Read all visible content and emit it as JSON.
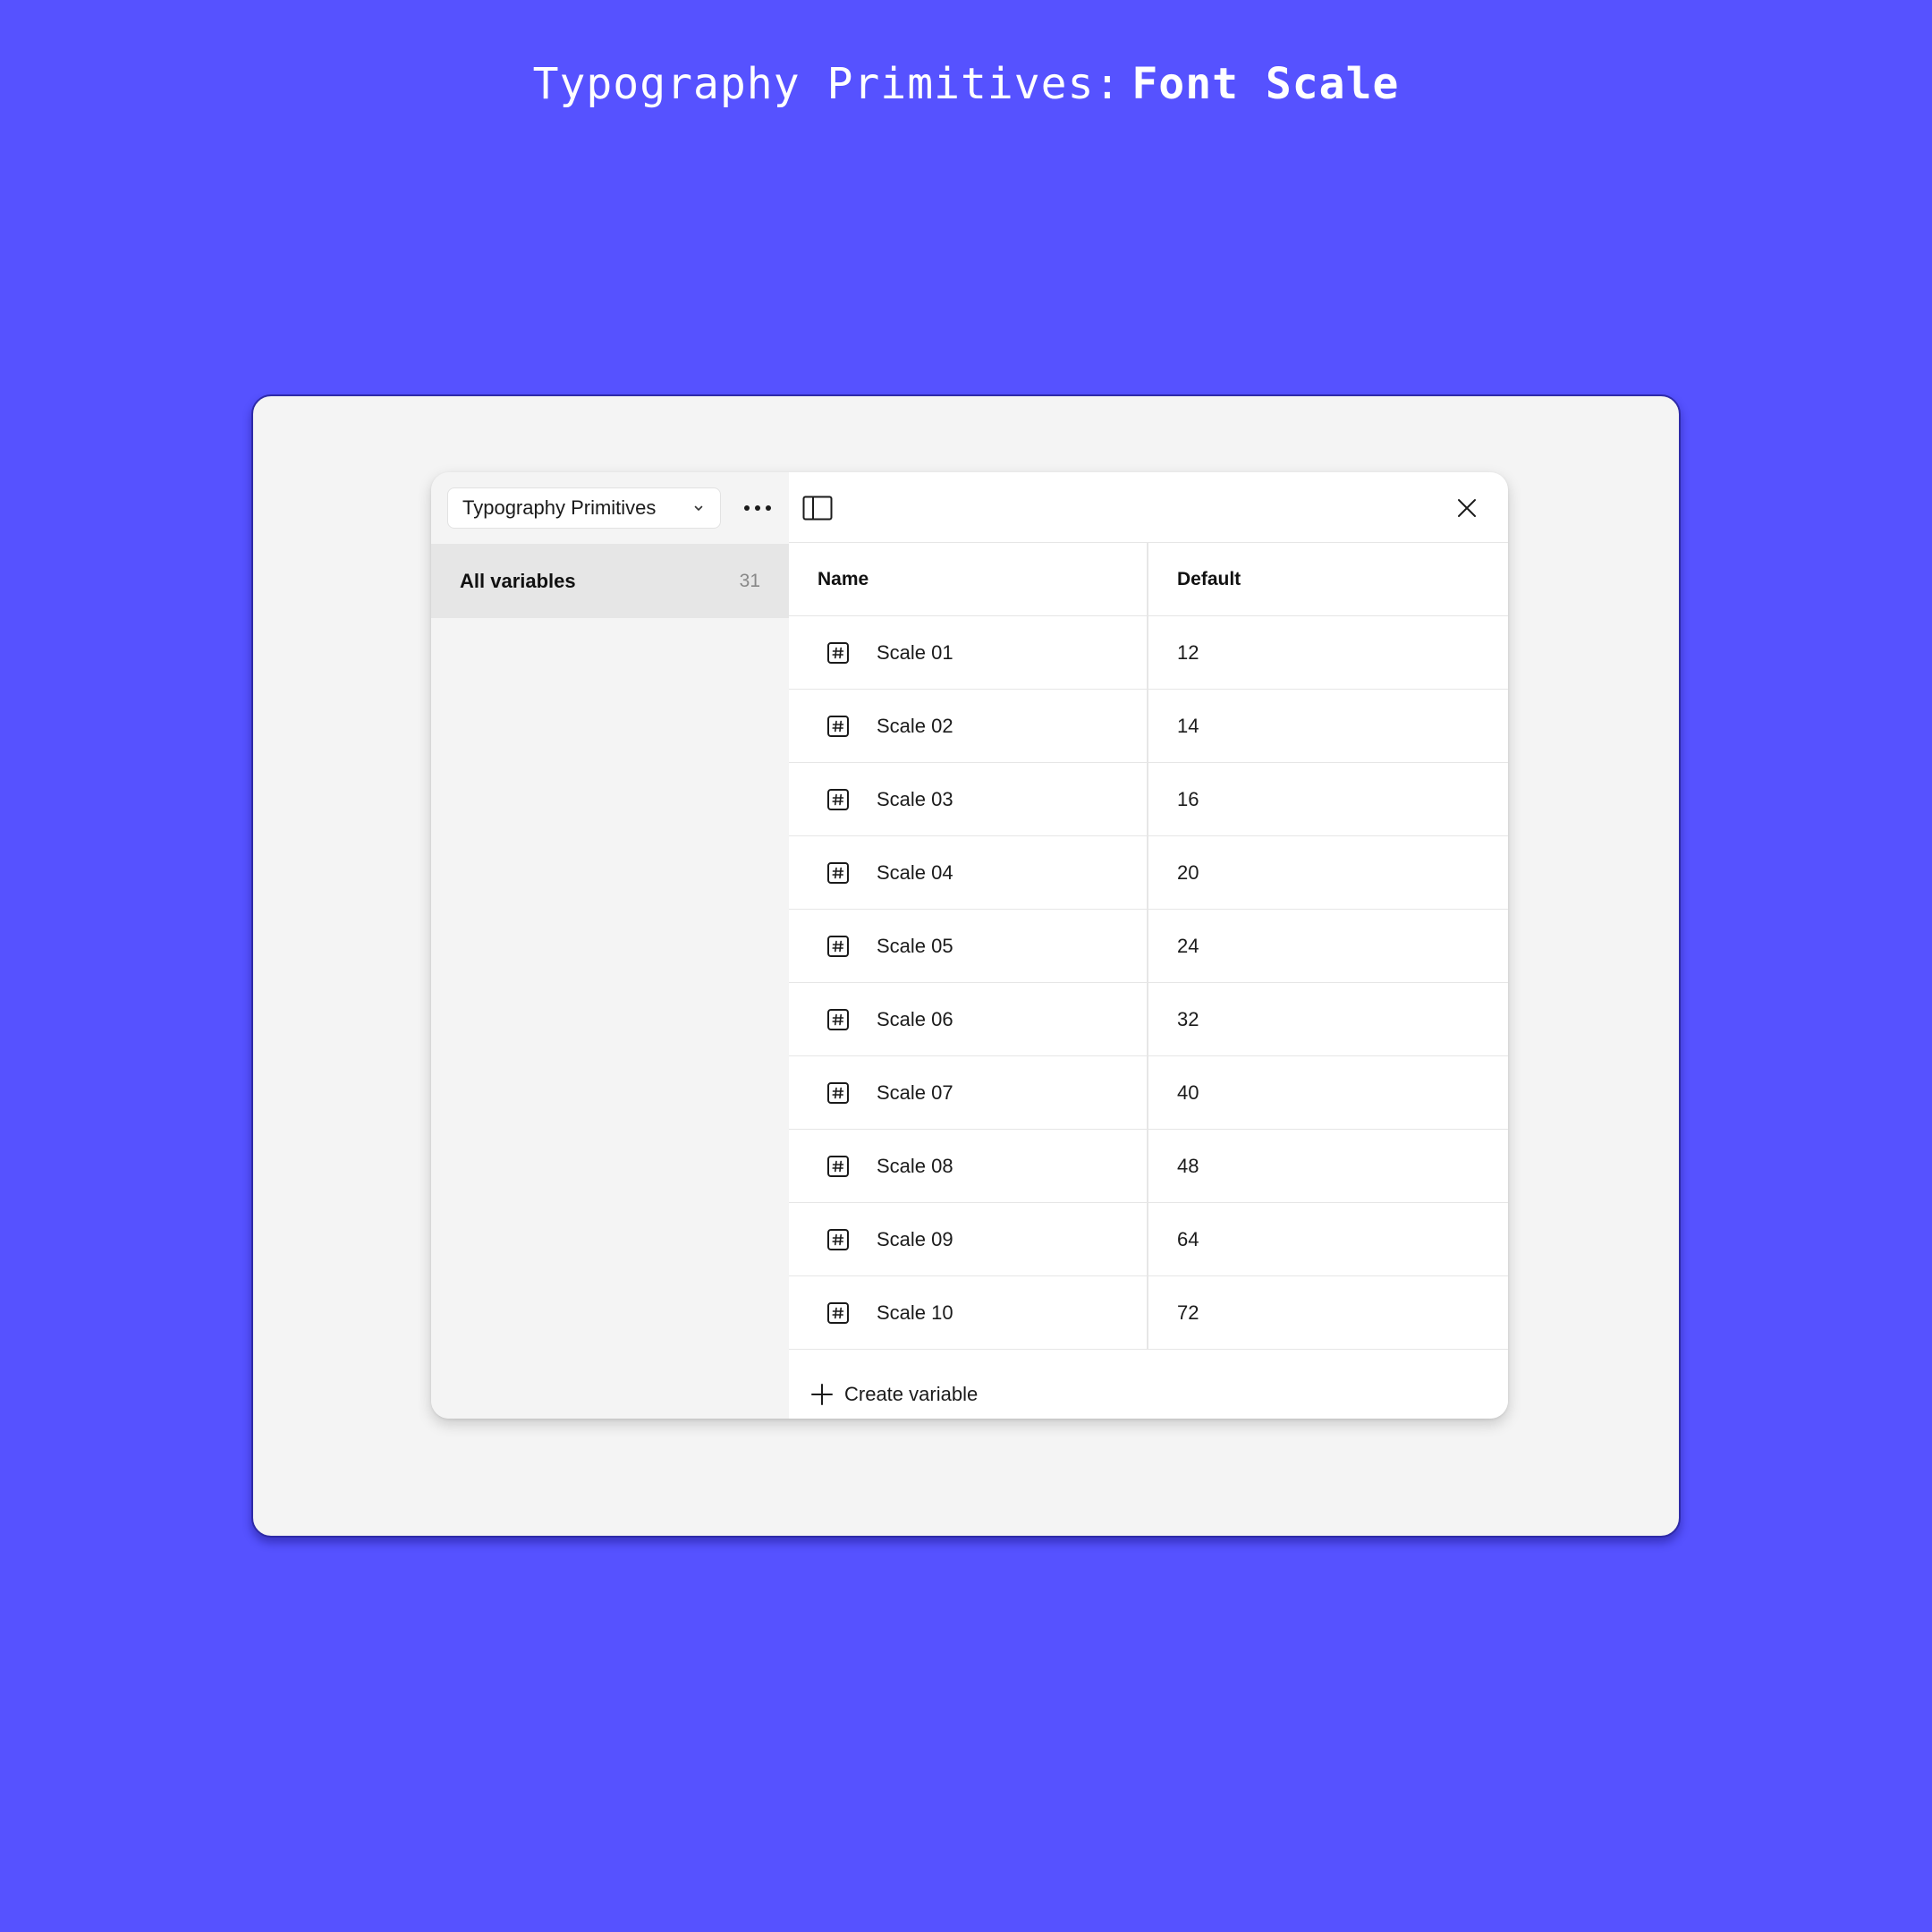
{
  "page": {
    "title_light": "Typography Primitives",
    "title_separator": ":",
    "title_bold": "Font Scale",
    "background_color": "#5652FF"
  },
  "sidebar": {
    "collection_select_value": "Typography Primitives",
    "groups": [
      {
        "label": "All variables",
        "count": "31",
        "selected": true
      }
    ]
  },
  "table": {
    "headers": {
      "name": "Name",
      "value": "Default"
    },
    "rows": [
      {
        "name": "Scale 01",
        "value": "12",
        "icon": "number-variable-icon"
      },
      {
        "name": "Scale 02",
        "value": "14",
        "icon": "number-variable-icon"
      },
      {
        "name": "Scale 03",
        "value": "16",
        "icon": "number-variable-icon"
      },
      {
        "name": "Scale 04",
        "value": "20",
        "icon": "number-variable-icon"
      },
      {
        "name": "Scale 05",
        "value": "24",
        "icon": "number-variable-icon"
      },
      {
        "name": "Scale 06",
        "value": "32",
        "icon": "number-variable-icon"
      },
      {
        "name": "Scale 07",
        "value": "40",
        "icon": "number-variable-icon"
      },
      {
        "name": "Scale 08",
        "value": "48",
        "icon": "number-variable-icon"
      },
      {
        "name": "Scale 09",
        "value": "64",
        "icon": "number-variable-icon"
      },
      {
        "name": "Scale 10",
        "value": "72",
        "icon": "number-variable-icon"
      }
    ]
  },
  "footer": {
    "create_label": "Create variable"
  }
}
